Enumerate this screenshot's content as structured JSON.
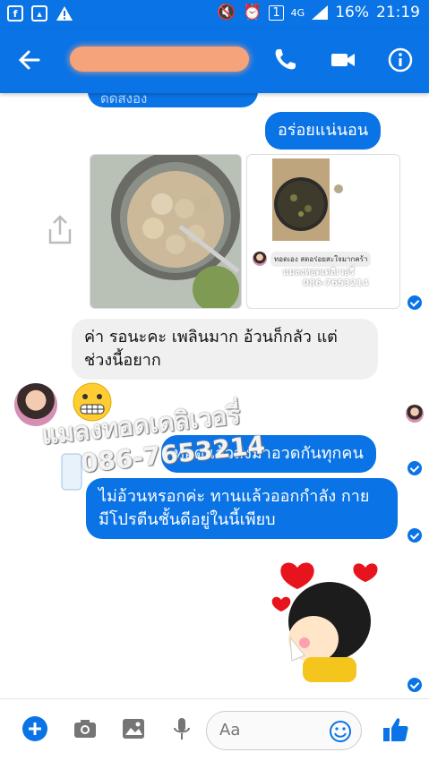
{
  "status_bar": {
    "notification_icons": [
      "facebook-icon",
      "gallery-icon",
      "warning-icon"
    ],
    "network": "4G",
    "sim": "1",
    "battery": "16%",
    "time": "21:19"
  },
  "header": {
    "partial_name": "ดดสงอง"
  },
  "messages": [
    {
      "type": "outgoing",
      "text": "อร่อยแน่นอน"
    },
    {
      "type": "incoming",
      "text": "ค่า  รอนะคะ เพลินมาก อ้วนก็กลัว แต่ ช่วงนี้อยาก"
    },
    {
      "type": "outgoing",
      "text": "ทอดแล้วส่งมาอวดกันทุกคน"
    },
    {
      "type": "outgoing",
      "text": "ไม่อ้วนหรอกค่ะ ทานแล้วออกกำลัง กาย มีโปรตีนชั้นดีอยู่ในนี้เพียบ"
    }
  ],
  "photo2": {
    "caption": "ทอดเอง สดอร่อยสะใจมากคร้า",
    "watermark_1": "แมลงทอดเดลิเวอรี่",
    "watermark_2": "086-7653214"
  },
  "watermark": {
    "line1": "แมลงทอดเดลิเวอรี่",
    "line2": "086-7653214"
  },
  "compose": {
    "placeholder": "Aa"
  },
  "colors": {
    "accent": "#0a73e6",
    "incoming_bubble": "#f1f0f0"
  }
}
